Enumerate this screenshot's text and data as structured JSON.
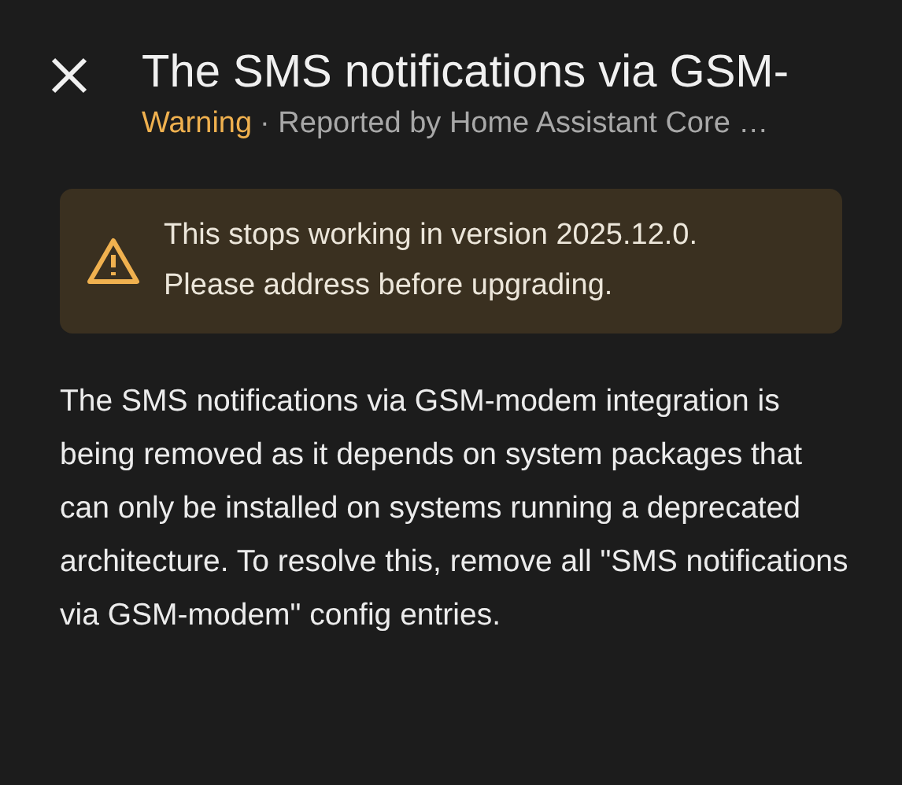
{
  "dialog": {
    "title": "The SMS notifications via GSM-",
    "severity": {
      "kind": "warning",
      "label": "Warning"
    },
    "subtitle": "· Reported by Home Assistant Core …"
  },
  "alert": {
    "kind": "warning",
    "lines": [
      "This stops working in version 2025.12.0.",
      "Please address before upgrading."
    ]
  },
  "description": "The SMS notifications via GSM-modem integration is being removed as it depends on system packages that can only be installed on systems running a deprecated architecture. To resolve this, remove all \"SMS notifications via GSM-modem\" config entries."
}
